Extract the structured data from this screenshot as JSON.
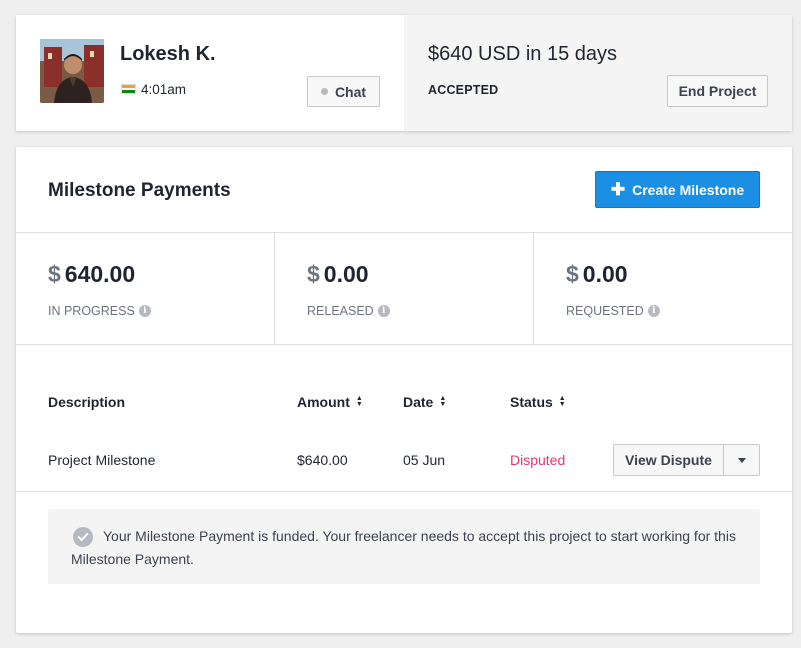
{
  "freelancer": {
    "name": "Lokesh K.",
    "local_time": "4:01am",
    "chat_label": "Chat"
  },
  "bid": {
    "amount": "$640 USD in 15 days",
    "status": "ACCEPTED",
    "end_project_label": "End Project"
  },
  "milestones": {
    "title": "Milestone Payments",
    "create_label": "Create Milestone",
    "stats": [
      {
        "currency": "$",
        "value": "640.00",
        "label": "IN PROGRESS"
      },
      {
        "currency": "$",
        "value": "0.00",
        "label": "RELEASED"
      },
      {
        "currency": "$",
        "value": "0.00",
        "label": "REQUESTED"
      }
    ],
    "columns": [
      "Description",
      "Amount",
      "Date",
      "Status"
    ],
    "rows": [
      {
        "description": "Project Milestone",
        "amount": "$640.00",
        "date": "05 Jun",
        "status": "Disputed",
        "action_label": "View Dispute"
      }
    ],
    "notice": "Your Milestone Payment is funded. Your freelancer needs to accept this project to start working for this Milestone Payment."
  },
  "colors": {
    "primary": "#1a8fe3",
    "disputed": "#e4366a"
  }
}
